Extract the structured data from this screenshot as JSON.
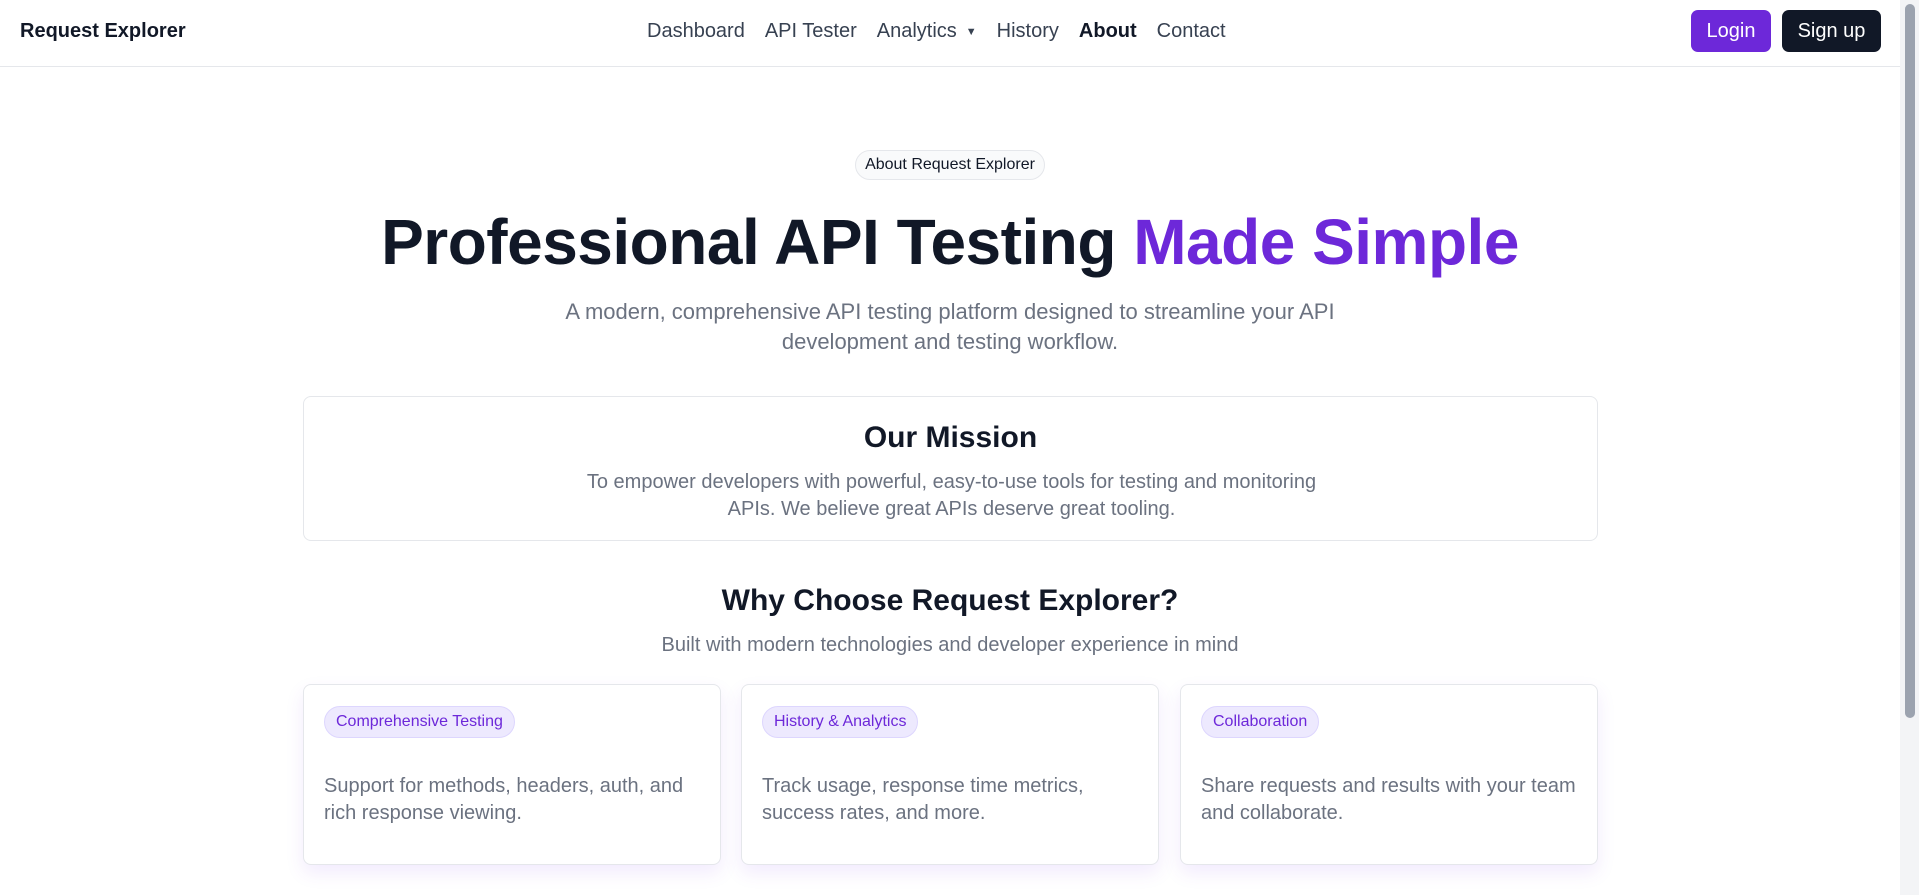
{
  "nav": {
    "brand": "Request Explorer",
    "links": [
      {
        "label": "Dashboard"
      },
      {
        "label": "API Tester"
      },
      {
        "label": "Analytics"
      },
      {
        "label": "History"
      },
      {
        "label": "About"
      },
      {
        "label": "Contact"
      }
    ],
    "active": "About",
    "login_label": "Login",
    "signup_label": "Sign up"
  },
  "hero": {
    "pill": "About Request Explorer",
    "title_main": "Professional API Testing ",
    "title_accent": "Made Simple",
    "subtitle": "A modern, comprehensive API testing platform designed to streamline your API development and testing workflow."
  },
  "mission": {
    "title": "Our Mission",
    "text": "To empower developers with powerful, easy-to-use tools for testing and monitoring APIs. We believe great APIs deserve great tooling."
  },
  "why": {
    "title": "Why Choose Request Explorer?",
    "subtitle": "Built with modern technologies and developer experience in mind"
  },
  "features": [
    {
      "tag": "Comprehensive Testing",
      "text": "Support for methods, headers, auth, and rich response viewing."
    },
    {
      "tag": "History & Analytics",
      "text": "Track usage, response time metrics, success rates, and more."
    },
    {
      "tag": "Collaboration",
      "text": "Share requests and results with your team and collaborate."
    }
  ],
  "colors": {
    "accent": "#6d28d9",
    "dark": "#111827",
    "muted": "#6b7280"
  }
}
